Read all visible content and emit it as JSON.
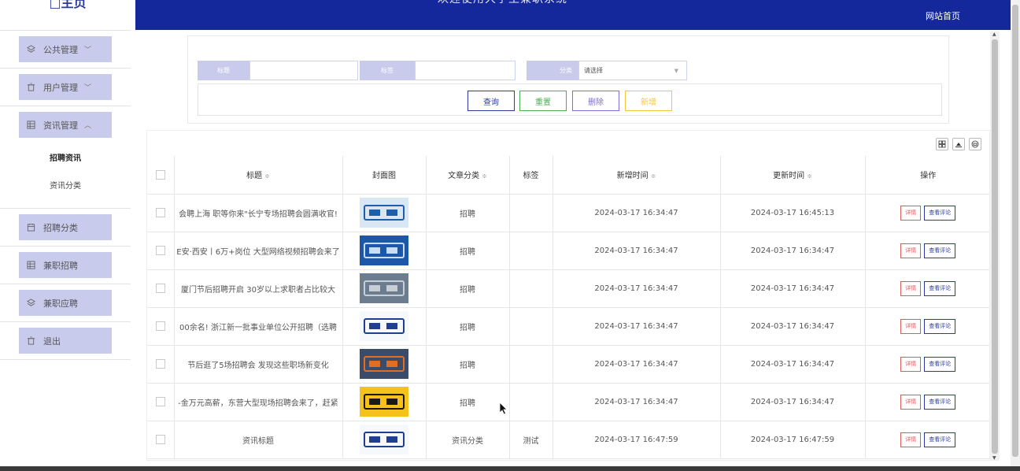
{
  "sidebar": {
    "home_title": "□主页",
    "menus": [
      {
        "label": "公共管理",
        "icon": "layers-icon",
        "chevron": "﹀"
      },
      {
        "label": "用户管理",
        "icon": "trash-icon",
        "chevron": "﹀"
      },
      {
        "label": "资讯管理",
        "icon": "grid-icon",
        "chevron": "︿"
      }
    ],
    "submenu": [
      {
        "label": "招聘资讯"
      },
      {
        "label": "资讯分类"
      }
    ],
    "menus_lower": [
      {
        "label": "招聘分类",
        "icon": "calendar-icon"
      },
      {
        "label": "兼职招聘",
        "icon": "grid-icon"
      },
      {
        "label": "兼职应聘",
        "icon": "layers-icon"
      },
      {
        "label": "退出",
        "icon": "trash-icon"
      }
    ]
  },
  "header": {
    "title": "欢迎使用大学生兼职系统",
    "home_link": "网站首页"
  },
  "search": {
    "title_label": "标题",
    "tag_label": "标签",
    "category_label": "分类",
    "category_placeholder": "请选择",
    "buttons": {
      "query": "查询",
      "reset": "重置",
      "delete": "删除",
      "add": "新增"
    }
  },
  "colors": {
    "header_bg": "#14289b",
    "menu_bg": "#c8cbec",
    "query": "#2b3a9e",
    "reset": "#4caf50",
    "delete": "#7b6fcf",
    "add": "#f5c542",
    "detail": "#e05a5a",
    "comments": "#2b3a9e"
  },
  "table": {
    "columns": [
      "标题",
      "封面图",
      "文章分类",
      "标签",
      "新增时间",
      "更新时间",
      "操作"
    ],
    "rows": [
      {
        "title": "会聘上海 职等你来\"长宁专场招聘会圆满收官!",
        "category": "招聘",
        "tag": "",
        "created": "2024-03-17 16:34:47",
        "updated": "2024-03-17 16:45:13",
        "cover": "招聘"
      },
      {
        "title": "E安·西安丨6万+岗位 大型网络视频招聘会来了",
        "category": "招聘",
        "tag": "",
        "created": "2024-03-17 16:34:47",
        "updated": "2024-03-17 16:34:47",
        "cover": "招聘会"
      },
      {
        "title": "厦门节后招聘开启 30岁以上求职者占比较大",
        "category": "招聘",
        "tag": "",
        "created": "2024-03-17 16:34:47",
        "updated": "2024-03-17 16:34:47",
        "cover": "photo"
      },
      {
        "title": "00余名! 浙江新一批事业单位公开招聘（选聘",
        "category": "招聘",
        "tag": "",
        "created": "2024-03-17 16:34:47",
        "updated": "2024-03-17 16:34:47",
        "cover": "招聘 等你来!"
      },
      {
        "title": "节后逛了5场招聘会 发现这些职场新变化",
        "category": "招聘",
        "tag": "",
        "created": "2024-03-17 16:34:47",
        "updated": "2024-03-17 16:34:47",
        "cover": "photo"
      },
      {
        "title": "-金万元高薪，东营大型现场招聘会来了，赶紧",
        "category": "招聘",
        "tag": "",
        "created": "2024-03-17 16:34:47",
        "updated": "2024-03-17 16:34:47",
        "cover": "招聘"
      },
      {
        "title": "资讯标题",
        "category": "资讯分类",
        "tag": "测试",
        "created": "2024-03-17 16:47:59",
        "updated": "2024-03-17 16:47:59",
        "cover": "招聘 等你来!"
      }
    ],
    "detail_label": "详情",
    "comments_label": "查看评论"
  },
  "toolbar_icons": [
    "columns-icon",
    "export-icon",
    "print-icon"
  ]
}
